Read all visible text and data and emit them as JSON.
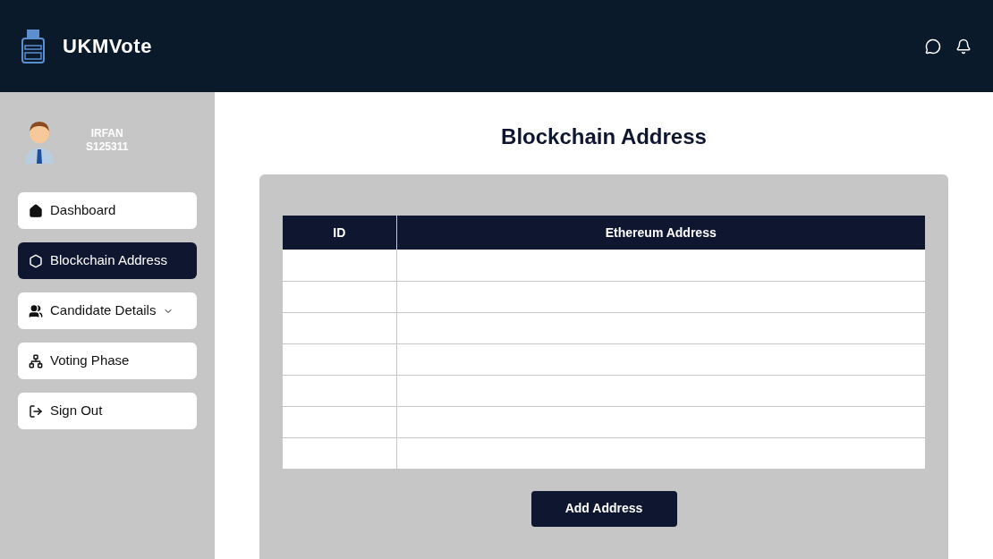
{
  "header": {
    "brand": "UKMVote"
  },
  "user": {
    "name": "IRFAN",
    "id": "S125311"
  },
  "sidebar": {
    "items": [
      {
        "label": "Dashboard",
        "selected": false,
        "kind": "link"
      },
      {
        "label": "Blockchain Address",
        "selected": true,
        "kind": "link"
      },
      {
        "label": "Candidate Details",
        "selected": false,
        "kind": "dropdown"
      },
      {
        "label": "Voting Phase",
        "selected": false,
        "kind": "link"
      },
      {
        "label": "Sign Out",
        "selected": false,
        "kind": "link"
      }
    ]
  },
  "page_title": "Blockchain Address",
  "table": {
    "columns": [
      "ID",
      "Ethereum Address"
    ]
  },
  "add_button": "Add Address"
}
